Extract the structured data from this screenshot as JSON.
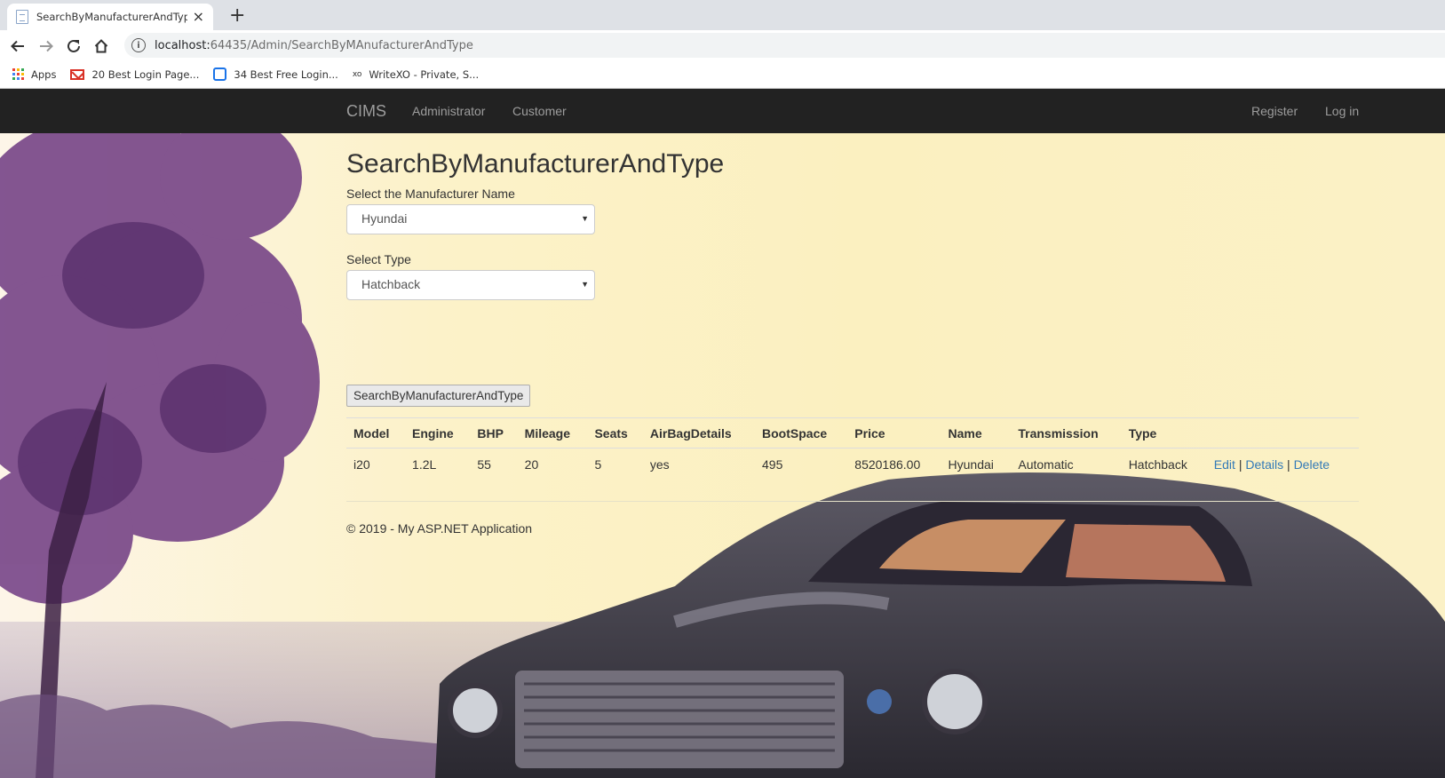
{
  "browser": {
    "tab_title": "SearchByManufacturerAndType",
    "tab_close": "×",
    "new_tab": "+",
    "url_host": "localhost:",
    "url_rest": "64435/Admin/SearchByMAnufacturerAndType",
    "bookmarks": [
      {
        "label": "Apps",
        "icon": "apps-grid-icon"
      },
      {
        "label": "20 Best Login Page...",
        "icon": "gmail-icon"
      },
      {
        "label": "34 Best Free Login...",
        "icon": "bookmark-page-icon"
      },
      {
        "label": "WriteXO - Private, S...",
        "icon": "xo-icon"
      }
    ],
    "xo_glyph": "xo"
  },
  "nav": {
    "brand": "CIMS",
    "links": [
      "Administrator",
      "Customer"
    ],
    "register": "Register",
    "login": "Log in"
  },
  "main": {
    "title": "SearchByManufacturerAndType",
    "manufacturer_label": "Select the Manufacturer Name",
    "manufacturer_value": "Hyundai",
    "type_label": "Select Type",
    "type_value": "Hatchback",
    "search_button": "SearchByManufacturerAndType"
  },
  "table": {
    "headers": [
      "Model",
      "Engine",
      "BHP",
      "Mileage",
      "Seats",
      "AirBagDetails",
      "BootSpace",
      "Price",
      "Name",
      "Transmission",
      "Type"
    ],
    "rows": [
      {
        "cells": [
          "i20",
          "1.2L",
          "55",
          "20",
          "5",
          "yes",
          "495",
          "8520186.00",
          "Hyundai",
          "Automatic",
          "Hatchback"
        ],
        "actions": [
          "Edit",
          "Details",
          "Delete"
        ],
        "separator": "|"
      }
    ]
  },
  "footer": "© 2019 - My ASP.NET Application",
  "colors": {
    "navbar_bg": "#222222",
    "nav_link": "#9d9d9d",
    "link": "#337ab7",
    "page_bg": "#fbf0c0"
  }
}
